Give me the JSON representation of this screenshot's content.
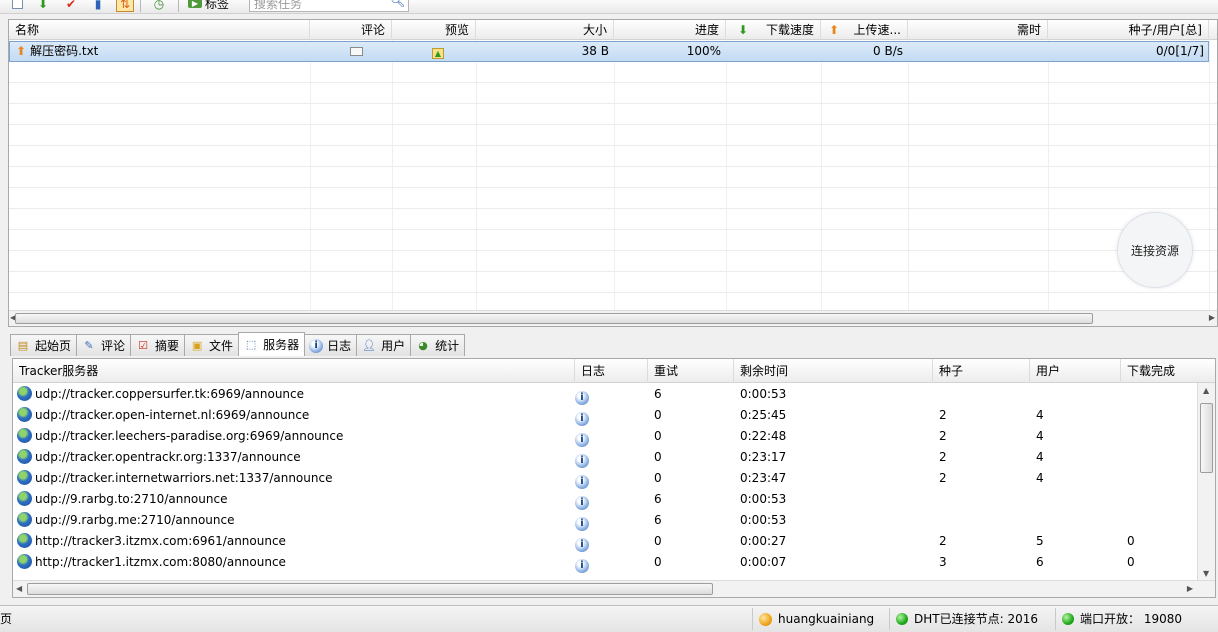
{
  "toolbar": {
    "tag_label": "标签",
    "search_placeholder": "搜索任务"
  },
  "tasks": {
    "columns": [
      "名称",
      "评论",
      "预览",
      "大小",
      "进度",
      "下载速度",
      "上传速...",
      "需时",
      "种子/用户[总]"
    ],
    "rows": [
      {
        "name": "解压密码.txt",
        "size": "38 B",
        "progress": "100%",
        "upload_speed": "0 B/s",
        "seeds_peers": "0/0[1/7]"
      }
    ],
    "connect_button": "连接资源"
  },
  "tabs": [
    {
      "label": "起始页"
    },
    {
      "label": "评论"
    },
    {
      "label": "摘要"
    },
    {
      "label": "文件"
    },
    {
      "label": "服务器",
      "active": true
    },
    {
      "label": "日志"
    },
    {
      "label": "用户"
    },
    {
      "label": "统计"
    }
  ],
  "trackers": {
    "columns": [
      "Tracker服务器",
      "日志",
      "重试",
      "剩余时间",
      "种子",
      "用户",
      "下载完成"
    ],
    "rows": [
      {
        "url": "udp://tracker.coppersurfer.tk:6969/announce",
        "retry": "6",
        "remaining": "0:00:53",
        "seeds": "",
        "peers": "",
        "completed": ""
      },
      {
        "url": "udp://tracker.open-internet.nl:6969/announce",
        "retry": "0",
        "remaining": "0:25:45",
        "seeds": "2",
        "peers": "4",
        "completed": ""
      },
      {
        "url": "udp://tracker.leechers-paradise.org:6969/announce",
        "retry": "0",
        "remaining": "0:22:48",
        "seeds": "2",
        "peers": "4",
        "completed": ""
      },
      {
        "url": "udp://tracker.opentrackr.org:1337/announce",
        "retry": "0",
        "remaining": "0:23:17",
        "seeds": "2",
        "peers": "4",
        "completed": ""
      },
      {
        "url": "udp://tracker.internetwarriors.net:1337/announce",
        "retry": "0",
        "remaining": "0:23:47",
        "seeds": "2",
        "peers": "4",
        "completed": ""
      },
      {
        "url": "udp://9.rarbg.to:2710/announce",
        "retry": "6",
        "remaining": "0:00:53",
        "seeds": "",
        "peers": "",
        "completed": ""
      },
      {
        "url": "udp://9.rarbg.me:2710/announce",
        "retry": "6",
        "remaining": "0:00:53",
        "seeds": "",
        "peers": "",
        "completed": ""
      },
      {
        "url": "http://tracker3.itzmx.com:6961/announce",
        "retry": "0",
        "remaining": "0:00:27",
        "seeds": "2",
        "peers": "5",
        "completed": "0"
      },
      {
        "url": "http://tracker1.itzmx.com:8080/announce",
        "retry": "0",
        "remaining": "0:00:07",
        "seeds": "3",
        "peers": "6",
        "completed": "0"
      }
    ]
  },
  "statusbar": {
    "left": "页",
    "username": "huangkuainiang",
    "dht": "DHT已连接节点: 2016",
    "port": "端口开放： 19080"
  }
}
